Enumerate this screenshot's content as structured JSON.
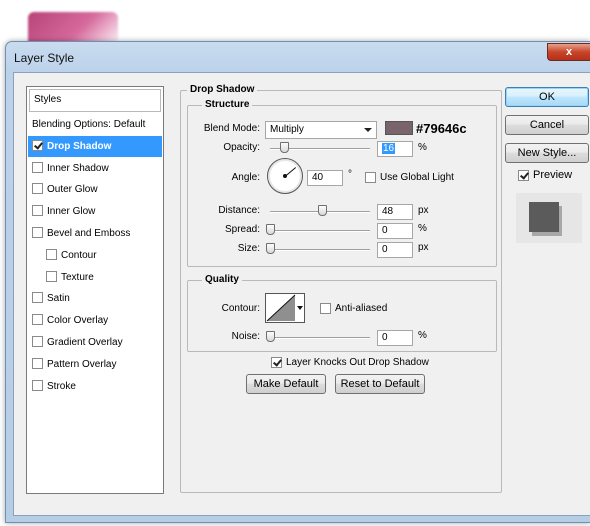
{
  "window": {
    "title": "Layer Style",
    "close_label": "x"
  },
  "styles": {
    "header": "Styles",
    "items": [
      {
        "label": "Blending Options: Default",
        "checkbox": false,
        "checked": false
      },
      {
        "label": "Drop Shadow",
        "checkbox": true,
        "checked": true,
        "selected": true
      },
      {
        "label": "Inner Shadow",
        "checkbox": true,
        "checked": false
      },
      {
        "label": "Outer Glow",
        "checkbox": true,
        "checked": false
      },
      {
        "label": "Inner Glow",
        "checkbox": true,
        "checked": false
      },
      {
        "label": "Bevel and Emboss",
        "checkbox": true,
        "checked": false
      },
      {
        "label": "Contour",
        "checkbox": true,
        "checked": false,
        "indent": true
      },
      {
        "label": "Texture",
        "checkbox": true,
        "checked": false,
        "indent": true
      },
      {
        "label": "Satin",
        "checkbox": true,
        "checked": false
      },
      {
        "label": "Color Overlay",
        "checkbox": true,
        "checked": false
      },
      {
        "label": "Gradient Overlay",
        "checkbox": true,
        "checked": false
      },
      {
        "label": "Pattern Overlay",
        "checkbox": true,
        "checked": false
      },
      {
        "label": "Stroke",
        "checkbox": true,
        "checked": false
      }
    ]
  },
  "drop_shadow": {
    "title": "Drop Shadow",
    "structure": {
      "title": "Structure",
      "blend_mode_label": "Blend Mode:",
      "blend_mode_value": "Multiply",
      "color": "#79646c",
      "color_label": "#79646c",
      "opacity_label": "Opacity:",
      "opacity_value": "16",
      "opacity_unit": "%",
      "angle_label": "Angle:",
      "angle_value": "40",
      "angle_unit": "°",
      "global_light_label": "Use Global Light",
      "global_light_checked": false,
      "distance_label": "Distance:",
      "distance_value": "48",
      "distance_unit": "px",
      "spread_label": "Spread:",
      "spread_value": "0",
      "spread_unit": "%",
      "size_label": "Size:",
      "size_value": "0",
      "size_unit": "px"
    },
    "quality": {
      "title": "Quality",
      "contour_label": "Contour:",
      "anti_aliased_label": "Anti-aliased",
      "anti_aliased_checked": false,
      "noise_label": "Noise:",
      "noise_value": "0",
      "noise_unit": "%"
    },
    "knocks_out_label": "Layer Knocks Out Drop Shadow",
    "knocks_out_checked": true,
    "make_default_label": "Make Default",
    "reset_default_label": "Reset to Default"
  },
  "buttons": {
    "ok": "OK",
    "cancel": "Cancel",
    "new_style": "New Style...",
    "preview_label": "Preview",
    "preview_checked": true
  }
}
